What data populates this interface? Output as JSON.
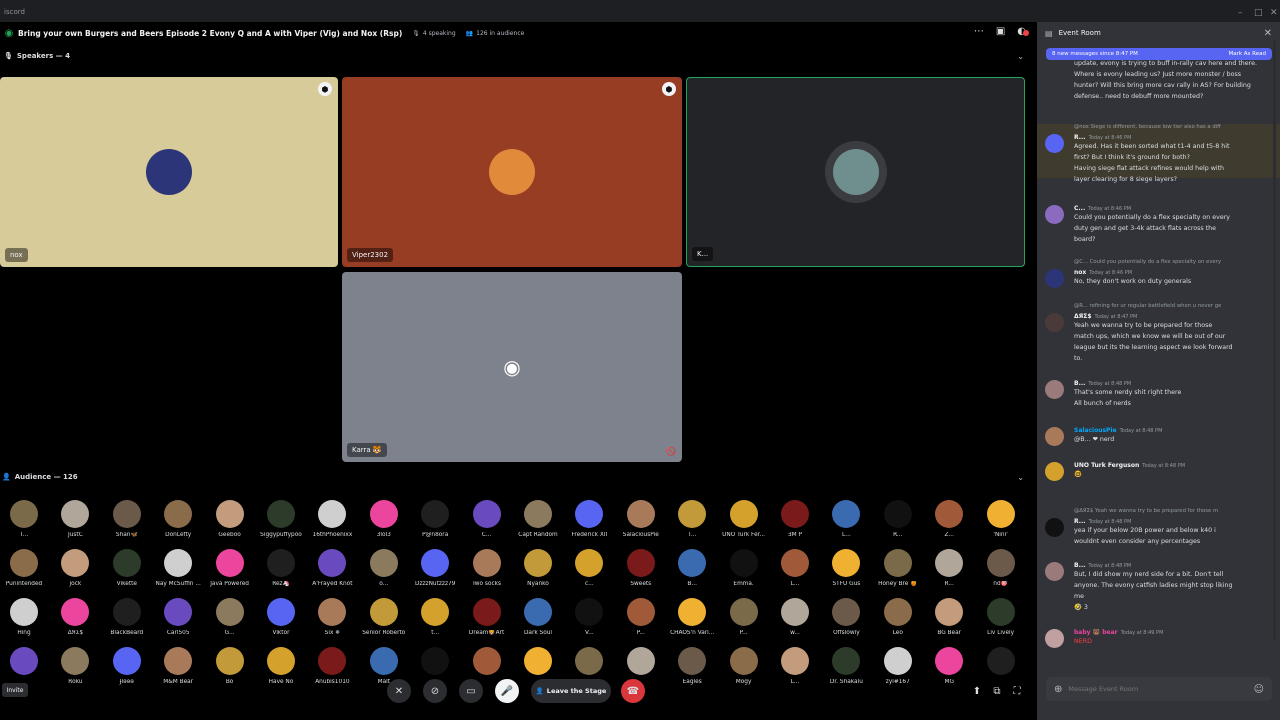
{
  "window": {
    "app_name": "iscord",
    "controls": [
      "–",
      "□",
      "✕"
    ]
  },
  "stage": {
    "title": "Bring your own Burgers and Beers Episode 2 Evony Q and A with Viper (Vig) and Nox (Rsp)",
    "speaking": "4 speaking",
    "audience_count": "126 in audience",
    "speakers_label": "Speakers — 4",
    "audience_label": "Audience — 126"
  },
  "speakers": [
    {
      "name": "nox",
      "bg": "#d7cb99",
      "avatar": "#2c3577",
      "mod": true
    },
    {
      "name": "Viper2302",
      "bg": "#963d23",
      "avatar": "#e08a3a",
      "mod": true
    },
    {
      "name": "K...",
      "bg": "#232428",
      "avatar": "#6f8f8f",
      "mod": false
    },
    {
      "name": "Karra 🐯",
      "bg": "#7d828d",
      "avatar": "#ffffff",
      "mod": false
    }
  ],
  "audience": [
    [
      "T...",
      "JustC",
      "Shan🦋",
      "DonLefty",
      "Geeboo",
      "Siggypuffypoo",
      "16thPhoenixx",
      "3lol3",
      "P@n8ora",
      "C...",
      "Capt Random",
      "Frederick XII",
      "SalaciousPie",
      "T...",
      "UNO Turk Fer...",
      "ƎM P",
      "L...",
      "R...",
      "Z...",
      "'Nini'"
    ],
    [
      "Punintended",
      "jock",
      "Vikette",
      "Nay McSuffin ...",
      "Java Powered",
      "Rez🦄",
      "A'Frayed Knot",
      "o...",
      "DzzzNutzzz79",
      "Two socks",
      "Nyanko",
      "c...",
      "Sweets",
      "B...",
      "Emma.",
      "L...",
      "STFU Gus",
      "Honey Bre 🍯",
      "R...",
      "nd🎯"
    ],
    [
      "Hing",
      "ΔЯΣ$",
      "BlackBeard",
      "Carl505",
      "G...",
      "Viktor",
      "Six ❄",
      "Senior Roberto",
      "t...",
      "Dream🦁Art",
      "Dark Soul",
      "V...",
      "P...",
      "CHAOS'n Vari...",
      "P...",
      "w...",
      "Offslowly",
      "Leo",
      "BG Bear",
      "Liv Lively"
    ],
    [
      "",
      "Roku",
      "Ɉlɘɘɘ",
      "M&M Bear",
      "Bo",
      "Have No",
      "Anubis1010",
      "Malt",
      "",
      "",
      "",
      "",
      "",
      "Eagles",
      "Mogy",
      "L...",
      "Dr. Shakalu",
      "zyl#167",
      "MG",
      ""
    ]
  ],
  "audience_colors": [
    "#7a6a4a",
    "#b0a69a",
    "#6b5a4a",
    "#8a6b4a",
    "#c29c7c",
    "#2d3b2b",
    "#cfcfcf",
    "#eb459e",
    "#1f1f1f",
    "#6a4bbf",
    "#8c7a5e",
    "#5865f2",
    "#a87a5a",
    "#c29a3a",
    "#d4a12c",
    "#7a1a1a",
    "#3a6ab0",
    "#111111",
    "#a05a3a",
    "#f0b132"
  ],
  "controls": {
    "invite": "Invite",
    "leave": "Leave the Stage"
  },
  "chat": {
    "title": "Event Room",
    "new_messages": "8 new messages since 8:47 PM",
    "mark_read": "Mark As Read",
    "placeholder": "Message Event Room",
    "top_text": "update, evony is trying to buff in-rally cav here and there. Where is evony leading us? Just more monster / boss hunter? Will this bring more cav rally in AS? For building defense.. need to debuff more mounted?",
    "messages": [
      {
        "reply": "@nox Siege is different, because low tier also has a diff",
        "name": "R...",
        "time": "Today at 8:46 PM",
        "lines": [
          "Agreed. Has it been sorted what t1-4 and t5-8 hit",
          "first? But I think it's ground for both?",
          "Having siege flat attack refines would help with",
          "layer clearing for 8 siege layers?"
        ],
        "color": "#5865f2"
      },
      {
        "name": "C...",
        "time": "Today at 8:46 PM",
        "lines": [
          "Could you potentially do a flex specialty on every",
          "duty gen and get 3-4k attack flats across the",
          "board?"
        ],
        "color": "#8a6bbf"
      },
      {
        "reply": "@C... Could you potentially do a flex specialty on every",
        "name": "nox",
        "time": "Today at 8:46 PM",
        "lines": [
          "No, they don't work on duty generals"
        ],
        "color": "#2c3577"
      },
      {
        "reply": "@R... refining for ur regular battlefield when u never ge",
        "name": "ΔЯΣ$",
        "time": "Today at 8:47 PM",
        "lines": [
          "Yeah we wanna try to be prepared for those",
          "match ups, which we know we will be out of our",
          "league but its the learning aspect we look forward",
          "to."
        ],
        "color": "#4a3a3a"
      },
      {
        "name": "B...",
        "time": "Today at 8:48 PM",
        "lines": [
          "That's some nerdy shit right there",
          "All bunch of nerds"
        ],
        "color": "#9a7a7a"
      },
      {
        "name": "SalaciousPie",
        "time": "Today at 8:48 PM",
        "lines": [
          "@B... ❤ nerd"
        ],
        "color": "#a87a5a"
      },
      {
        "name": "UNO Turk Ferguson",
        "time": "Today at 8:48 PM",
        "lines": [
          "🤓"
        ],
        "color": "#d4a12c"
      },
      {
        "reply": "@ΔЯΣ$ Yeah we wanna try to be prepared for those m",
        "name": "R...",
        "time": "Today at 8:48 PM",
        "lines": [
          "yea if your below 20B power and below k40 i",
          "wouldnt even consider any percentages"
        ],
        "color": "#111111"
      },
      {
        "name": "B...",
        "time": "Today at 8:48 PM",
        "lines": [
          "But, I did show my nerd side for a bit. Don't tell",
          "anyone. The evony catfish ladies might stop liking",
          "me",
          "🤣 3"
        ],
        "color": "#9a7a7a"
      },
      {
        "name": "baby 🐻 bear",
        "time": "Today at 8:49 PM",
        "lines": [
          "NERD"
        ],
        "color": "#c0a0a0"
      }
    ]
  }
}
